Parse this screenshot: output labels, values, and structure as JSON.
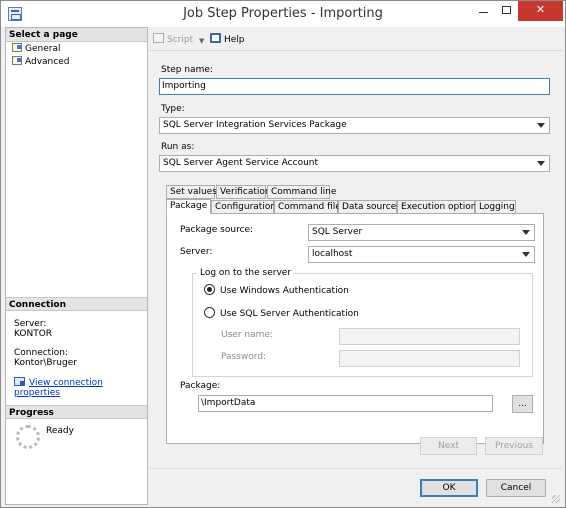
{
  "window": {
    "title": "Job Step Properties - Importing",
    "minimize_glyph": "",
    "maximize_glyph": "",
    "close_glyph": "✕"
  },
  "left_pane": {
    "select_page_header": "Select a page",
    "pages": [
      {
        "label": "General",
        "icon": "page-icon"
      },
      {
        "label": "Advanced",
        "icon": "page-icon"
      }
    ],
    "connection_header": "Connection",
    "server_label": "Server:",
    "server_value": "KONTOR",
    "connection_label": "Connection:",
    "connection_value": "Kontor\\Bruger",
    "view_connection_link": "View connection properties",
    "progress_header": "Progress",
    "progress_status": "Ready"
  },
  "toolbar": {
    "script_label": "Script",
    "help_label": "Help"
  },
  "form": {
    "step_name_label": "Step name:",
    "step_name_value": "Importing",
    "type_label": "Type:",
    "type_value": "SQL Server Integration Services Package",
    "run_as_label": "Run as:",
    "run_as_value": "SQL Server Agent Service Account"
  },
  "tabs": {
    "row1": [
      "Set values",
      "Verification",
      "Command line"
    ],
    "row2": [
      "Package",
      "Configurations",
      "Command files",
      "Data sources",
      "Execution options",
      "Logging"
    ],
    "active": "Package"
  },
  "package_tab": {
    "package_source_label": "Package source:",
    "package_source_value": "SQL Server",
    "server_label": "Server:",
    "server_value": "localhost",
    "logon_group_title": "Log on to the server",
    "windows_auth_label": "Use Windows Authentication",
    "windows_auth_selected": true,
    "sql_auth_label": "Use SQL Server Authentication",
    "sql_auth_selected": false,
    "username_label": "User name:",
    "username_value": "",
    "password_label": "Password:",
    "password_value": "",
    "package_label": "Package:",
    "package_value": "\\ImportData",
    "browse_label": "..."
  },
  "nav_buttons": {
    "next_label": "Next",
    "previous_label": "Previous"
  },
  "dialog_buttons": {
    "ok_label": "OK",
    "cancel_label": "Cancel"
  },
  "colors": {
    "link": "#0033cc",
    "close_button": "#c7372f",
    "focus_border": "#3c7fb1"
  }
}
